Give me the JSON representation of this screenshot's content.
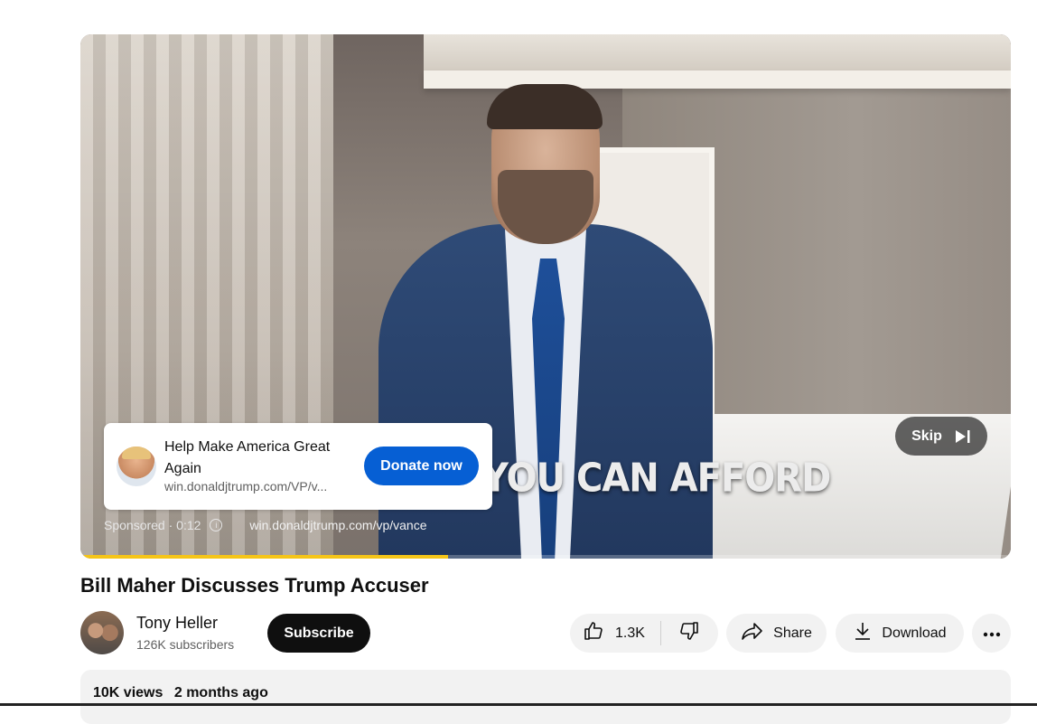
{
  "ad": {
    "title": "Help Make America Great Again",
    "url_short": "win.donaldjtrump.com/VP/v...",
    "cta": "Donate now",
    "sponsored": "Sponsored · 0:12",
    "meta_url": "win.donaldjtrump.com/vp/vance",
    "skip": "Skip",
    "progress_fraction": 0.395
  },
  "video": {
    "overlay_caption": "BUY IF YOU CAN AFFORD",
    "title": "Bill Maher Discusses Trump Accuser"
  },
  "channel": {
    "name": "Tony Heller",
    "subscribers": "126K subscribers",
    "subscribe_label": "Subscribe"
  },
  "actions": {
    "likes": "1.3K",
    "share": "Share",
    "download": "Download"
  },
  "description": {
    "views": "10K views",
    "age": "2 months ago"
  },
  "colors": {
    "accent_blue": "#065fd4",
    "progress_yellow": "#f5c518"
  }
}
